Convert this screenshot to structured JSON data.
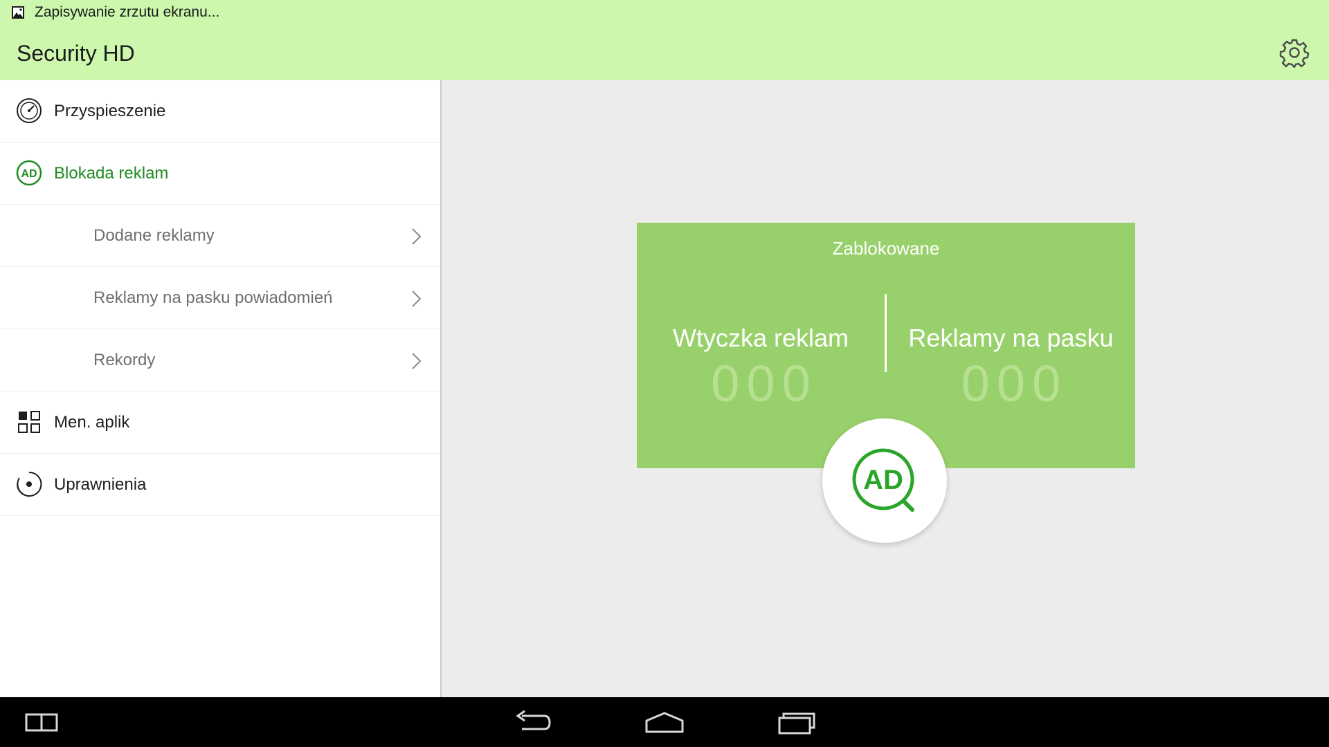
{
  "status_bar": {
    "notification_text": "Zapisywanie zrzutu ekranu...",
    "notification_icon": "image-icon"
  },
  "app_bar": {
    "title": "Security HD",
    "settings_icon": "gear-icon"
  },
  "sidebar": {
    "items": [
      {
        "label": "Przyspieszenie",
        "icon": "speedometer-icon",
        "type": "main"
      },
      {
        "label": "Blokada reklam",
        "icon": "ad-icon",
        "type": "main",
        "active": true
      },
      {
        "label": "Dodane reklamy",
        "type": "sub",
        "icon": "chevron-right-icon"
      },
      {
        "label": "Reklamy na pasku powiadomień",
        "type": "sub",
        "icon": "chevron-right-icon"
      },
      {
        "label": "Rekordy",
        "type": "sub",
        "icon": "chevron-right-icon"
      },
      {
        "label": "Men. aplik",
        "icon": "grid-apps-icon",
        "type": "main"
      },
      {
        "label": "Uprawnienia",
        "icon": "permissions-icon",
        "type": "main"
      }
    ]
  },
  "blocked_card": {
    "title": "Zablokowane",
    "left": {
      "label": "Wtyczka reklam",
      "count": "000"
    },
    "right": {
      "label": "Reklamy na pasku",
      "count": "000"
    },
    "scan_button_icon": "ad-search-icon"
  },
  "nav_bar": {
    "buttons": [
      "split-screen-icon",
      "back-icon",
      "home-icon",
      "recents-icon"
    ]
  },
  "colors": {
    "header_bg": "#ccf7ac",
    "accent": "#1f8a1f",
    "card_bg": "#98d16b",
    "count_color": "#b7e090"
  }
}
